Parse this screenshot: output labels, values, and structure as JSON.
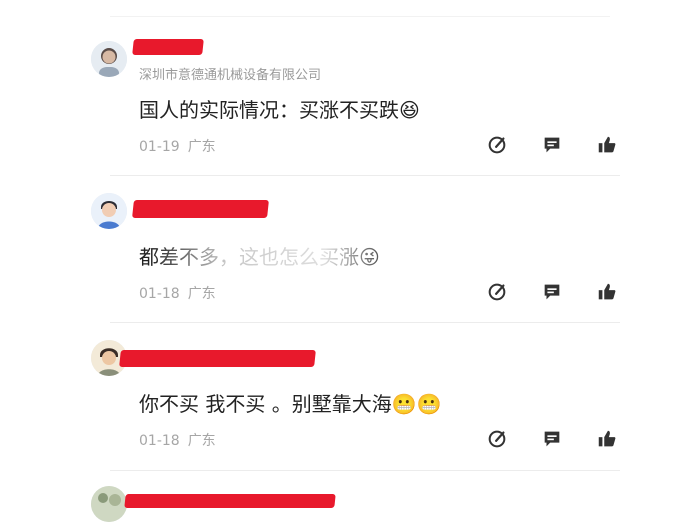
{
  "comments": [
    {
      "company": "深圳市意德通机械设备有限公司",
      "text": "国人的实际情况：买涨不买跌",
      "emoji": "😆",
      "date": "01-19",
      "location": "广东"
    },
    {
      "company": "",
      "text": "都差不多，这也怎么买涨",
      "emoji": "😜",
      "date": "01-18",
      "location": "广东"
    },
    {
      "company": "",
      "text": "你不买 我不买 。别墅靠大海",
      "emoji": "😬😬",
      "date": "01-18",
      "location": "广东"
    }
  ],
  "colors": {
    "redact": "#e8192c",
    "text": "#222222",
    "meta": "#a6a6a6",
    "icon": "#333333"
  },
  "icons": {
    "reply": "edit-icon",
    "message": "comment-icon",
    "like": "thumbs-up-icon"
  }
}
